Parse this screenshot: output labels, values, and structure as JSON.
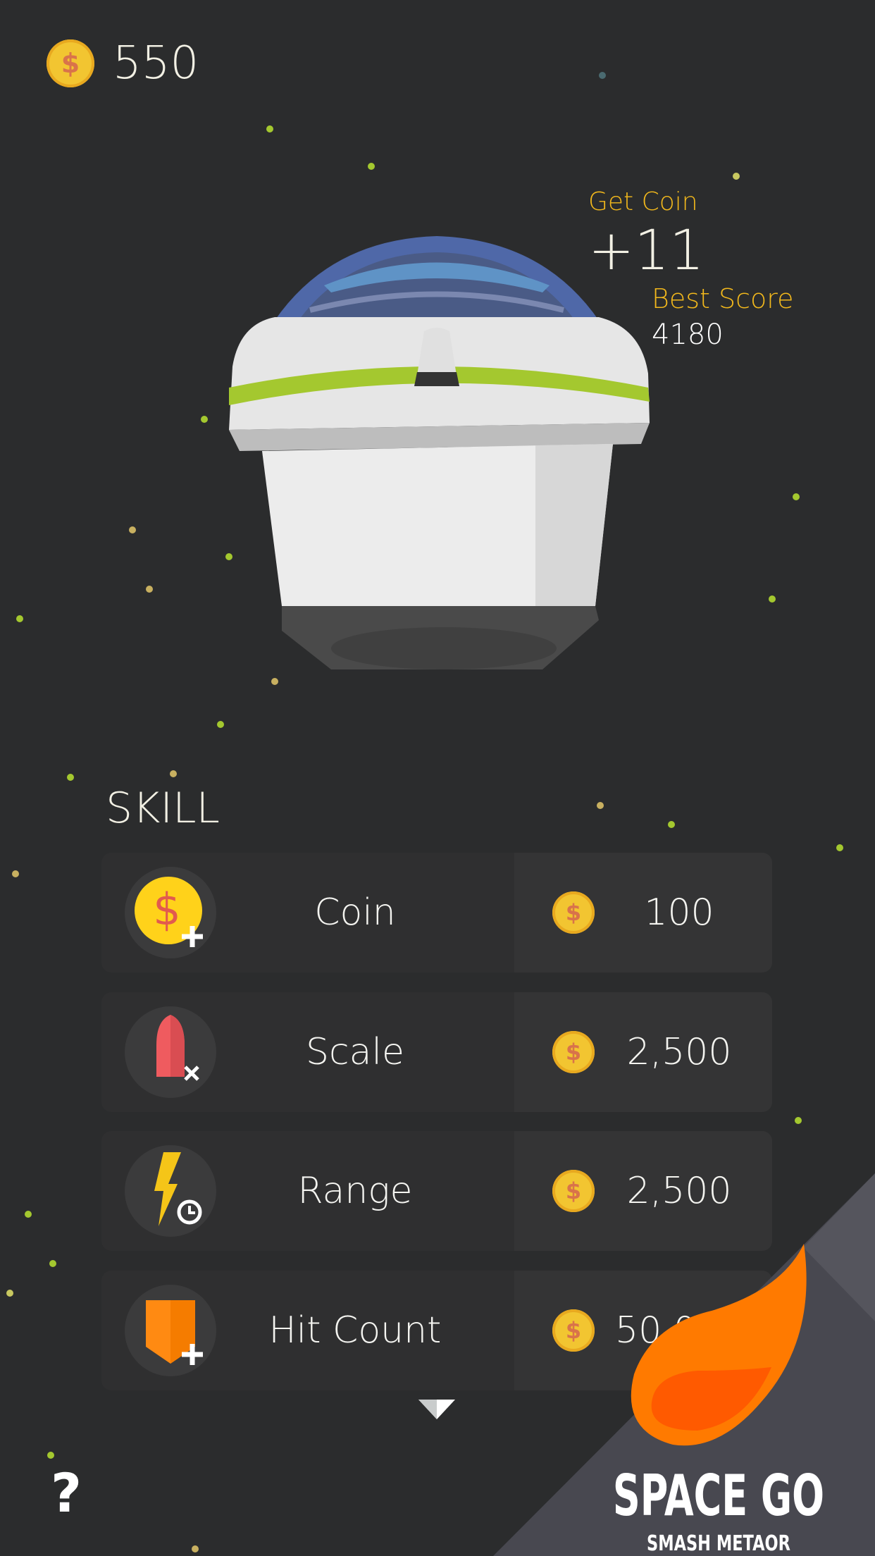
{
  "header": {
    "coin_icon": "dollar-coin-icon",
    "coins": "550"
  },
  "result": {
    "get_coin_label": "Get Coin",
    "get_coin_value": "+11",
    "best_score_label": "Best Score",
    "best_score_value": "4180"
  },
  "skills": {
    "title": "SKILL",
    "items": [
      {
        "label": "Coin",
        "price": "100",
        "icon": "coin-plus-icon"
      },
      {
        "label": "Scale",
        "price": "2,500",
        "icon": "rocket-expand-icon"
      },
      {
        "label": "Range",
        "price": "2,500",
        "icon": "lightning-clock-icon"
      },
      {
        "label": "Hit Count",
        "price": "50,000",
        "icon": "shield-plus-icon"
      }
    ],
    "more_icon": "chevron-down-icon"
  },
  "help": {
    "label": "?"
  },
  "logo": {
    "title": "SPACE GO",
    "subtitle": "SMASH METAOR"
  },
  "colors": {
    "background": "#2b2c2d",
    "accent": "#f2b81c",
    "row": "#2f2f30",
    "logo_flame": "#ff7a00"
  }
}
